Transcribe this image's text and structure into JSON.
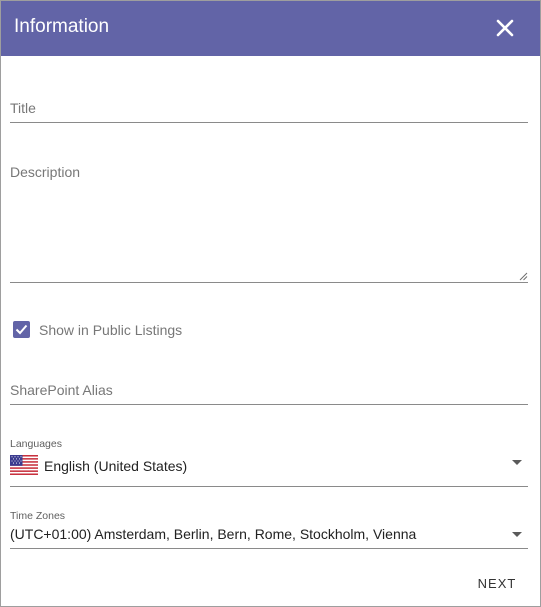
{
  "header": {
    "title": "Information",
    "close_icon": "close-icon",
    "background_color": "#6264a7"
  },
  "form": {
    "title_placeholder": "Title",
    "description_placeholder": "Description",
    "public_listings": {
      "label": "Show in Public Listings",
      "checked": true
    },
    "sharepoint_alias_placeholder": "SharePoint Alias",
    "languages": {
      "label": "Languages",
      "value": "English (United States)",
      "flag_icon": "us-flag-icon"
    },
    "time_zones": {
      "label": "Time Zones",
      "value": "(UTC+01:00) Amsterdam, Berlin, Bern, Rome, Stockholm, Vienna"
    }
  },
  "footer": {
    "next_label": "NEXT"
  }
}
